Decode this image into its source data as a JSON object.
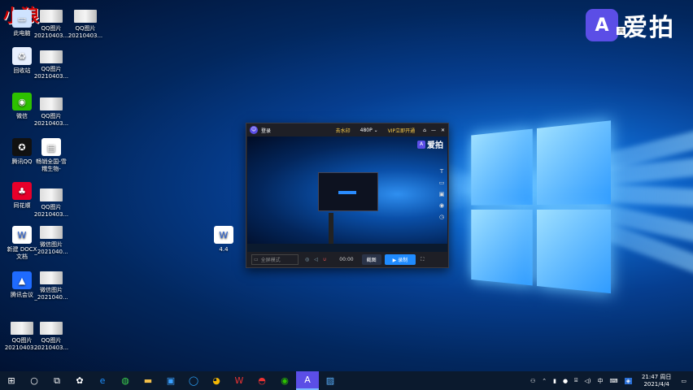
{
  "watermark": "小狼",
  "brand": {
    "name": "爱拍",
    "icon": "A",
    "badge": "共"
  },
  "desktop_icons": [
    {
      "label": "此电脑",
      "icon": "computer-icon"
    },
    {
      "label": "QQ图片\n20210403...",
      "icon": "image-icon"
    },
    {
      "label": "QQ图片\n20210403...",
      "icon": "image-icon"
    },
    {
      "label": "回收站",
      "icon": "recycle-bin-icon"
    },
    {
      "label": "QQ图片\n20210403...",
      "icon": "image-icon"
    },
    {
      "label": "微信",
      "icon": "wechat-icon"
    },
    {
      "label": "QQ图片\n20210403...",
      "icon": "image-icon"
    },
    {
      "label": "腾讯QQ",
      "icon": "qq-icon"
    },
    {
      "label": "畅销全国-雪\n糯生物-",
      "icon": "document-icon"
    },
    {
      "label": "同花顺",
      "icon": "tonghuashun-icon"
    },
    {
      "label": "QQ图片\n20210403...",
      "icon": "image-icon"
    },
    {
      "label": "新建 DOCX\n文档",
      "icon": "docx-icon"
    },
    {
      "label": "微信图片\n_2021040...",
      "icon": "image-icon"
    },
    {
      "label": "腾讯会议",
      "icon": "tencent-meeting-icon"
    },
    {
      "label": "微信图片\n_2021040...",
      "icon": "image-icon"
    },
    {
      "label": "QQ图片\n20210403...",
      "icon": "image-icon"
    },
    {
      "label": "QQ图片\n20210403...",
      "icon": "image-icon"
    },
    {
      "label": "4.4",
      "icon": "docx-icon"
    }
  ],
  "recorder": {
    "title_login": "登录",
    "remove_watermark": "去水印",
    "quality": "480P",
    "vip": "VIP立即开通",
    "preview_brand": "爱拍",
    "source_placeholder": "全屏模式",
    "timer": "00:00",
    "screenshot_btn": "截图",
    "record_btn": "录制"
  },
  "taskbar": {
    "apps": [
      "start-icon",
      "search-icon",
      "task-view-icon",
      "fan-icon",
      "edge-icon",
      "360-icon",
      "file-explorer-icon",
      "store-icon",
      "browser-icon",
      "chrome-icon",
      "wps-icon",
      "ball-icon",
      "wechat-icon",
      "aipai-icon",
      "photos-icon"
    ],
    "tray_lang": "中",
    "time": "21:47 周日",
    "date": "2021/4/4"
  }
}
